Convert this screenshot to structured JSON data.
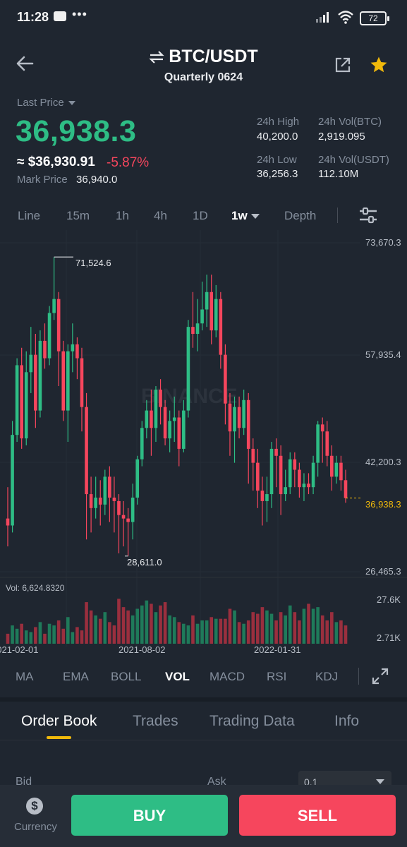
{
  "status_bar": {
    "time": "11:28",
    "dots": "•••",
    "battery": "72"
  },
  "header": {
    "pair": "BTC/USDT",
    "contract": "Quarterly 0624",
    "icons": {
      "back": "arrow-left-icon",
      "swap": "swap-arrows-icon",
      "share": "share-icon",
      "favorite": "star-icon"
    },
    "favorite_color": "#f0b90b"
  },
  "price": {
    "last_price_label": "Last Price",
    "last_price": "36,938.3",
    "approx_usd": "≈ $36,930.91",
    "change_pct": "-5.87%",
    "mark_price_label": "Mark Price",
    "mark_price": "36,940.0",
    "colors": {
      "up": "#2ebd85",
      "down": "#f6465d"
    }
  },
  "stats": {
    "high_label": "24h High",
    "high": "40,200.0",
    "vol_btc_label": "24h Vol(BTC)",
    "vol_btc": "2,919.095",
    "low_label": "24h Low",
    "low": "36,256.3",
    "vol_usdt_label": "24h Vol(USDT)",
    "vol_usdt": "112.10M"
  },
  "timeframes": {
    "items": [
      "Line",
      "15m",
      "1h",
      "4h",
      "1D",
      "1w",
      "Depth"
    ],
    "active": "1w"
  },
  "chart_data": {
    "type": "candlestick",
    "watermark": "BINANCE",
    "price_axis": [
      "73,670.3",
      "57,935.4",
      "42,200.3",
      "26,465.3"
    ],
    "current_price": "36,938.3",
    "annotations": {
      "high": "71,524.6",
      "low": "28,611.0"
    },
    "volume_label": "Vol: 6,624.8320",
    "volume_axis": [
      "27.6K",
      "2.71K"
    ],
    "dates": [
      "2021-02-01",
      "2021-08-02",
      "2022-01-31"
    ],
    "ylim": [
      26465.3,
      73670.3
    ],
    "candles": [
      [
        34000,
        33000,
        38500,
        30000
      ],
      [
        33000,
        46000,
        48000,
        32000
      ],
      [
        46000,
        56000,
        57000,
        45000
      ],
      [
        56000,
        45500,
        58500,
        44000
      ],
      [
        45500,
        55000,
        58000,
        44500
      ],
      [
        55000,
        57500,
        61500,
        52000
      ],
      [
        57500,
        49500,
        60500,
        47000
      ],
      [
        49500,
        59500,
        61000,
        48500
      ],
      [
        59500,
        57000,
        62000,
        55500
      ],
      [
        57000,
        63500,
        64500,
        56000
      ],
      [
        63500,
        65500,
        71524.6,
        62500
      ],
      [
        65500,
        58000,
        66500,
        53000
      ],
      [
        58000,
        49500,
        59500,
        48000
      ],
      [
        49500,
        58000,
        59000,
        45000
      ],
      [
        58000,
        59000,
        62000,
        55000
      ],
      [
        59000,
        57000,
        60000,
        54000
      ],
      [
        57000,
        50000,
        58500,
        46500
      ],
      [
        50000,
        37500,
        52000,
        31000
      ],
      [
        37500,
        35500,
        40000,
        32000
      ],
      [
        35500,
        37000,
        40000,
        34000
      ],
      [
        37000,
        36000,
        39500,
        33000
      ],
      [
        36000,
        40000,
        41000,
        34500
      ],
      [
        40000,
        37000,
        41500,
        33500
      ],
      [
        37000,
        36500,
        40000,
        32000
      ],
      [
        36500,
        34500,
        37500,
        29000
      ],
      [
        34500,
        34000,
        36500,
        30000
      ],
      [
        34000,
        33500,
        35500,
        28611.0
      ],
      [
        33500,
        37000,
        39000,
        31000
      ],
      [
        37000,
        42500,
        43000,
        36000
      ],
      [
        42500,
        47000,
        48000,
        41500
      ],
      [
        47000,
        49500,
        51000,
        45500
      ],
      [
        49500,
        47000,
        52500,
        43000
      ],
      [
        47000,
        52500,
        53000,
        45000
      ],
      [
        52500,
        50000,
        54000,
        47500
      ],
      [
        50000,
        45500,
        51000,
        44500
      ],
      [
        45500,
        48000,
        49500,
        43500
      ],
      [
        48000,
        48500,
        51500,
        45000
      ],
      [
        48500,
        44000,
        49500,
        41500
      ],
      [
        44000,
        49500,
        51000,
        43500
      ],
      [
        49500,
        61500,
        62500,
        48500
      ],
      [
        61500,
        60500,
        66500,
        58500
      ],
      [
        60500,
        62000,
        65500,
        58000
      ],
      [
        62000,
        64000,
        68000,
        61000
      ],
      [
        64000,
        66500,
        69000,
        61500
      ],
      [
        66500,
        61000,
        69000,
        59000
      ],
      [
        61000,
        65500,
        67500,
        60000
      ],
      [
        65500,
        57500,
        66500,
        55500
      ],
      [
        57500,
        50500,
        59000,
        47500
      ],
      [
        50500,
        46500,
        52000,
        43000
      ],
      [
        46500,
        50000,
        51500,
        42000
      ],
      [
        50000,
        47000,
        51500,
        45500
      ],
      [
        47000,
        51000,
        52500,
        46000
      ],
      [
        51000,
        44000,
        52000,
        39000
      ],
      [
        44000,
        42000,
        45500,
        38000
      ],
      [
        42000,
        38000,
        44000,
        35500
      ],
      [
        38000,
        36500,
        40000,
        33000
      ],
      [
        36500,
        37500,
        40000,
        33500
      ],
      [
        37500,
        44000,
        45000,
        35500
      ],
      [
        44000,
        43000,
        45500,
        38500
      ],
      [
        43000,
        37500,
        44500,
        34500
      ],
      [
        37500,
        38500,
        41000,
        36500
      ],
      [
        38500,
        42500,
        43500,
        37500
      ],
      [
        42500,
        41000,
        43500,
        38500
      ],
      [
        41000,
        38500,
        42000,
        37000
      ],
      [
        38500,
        39000,
        40500,
        36500
      ],
      [
        39000,
        38500,
        40500,
        37500
      ],
      [
        38500,
        42000,
        43000,
        37500
      ],
      [
        42000,
        47500,
        48000,
        40000
      ],
      [
        47500,
        46500,
        48500,
        42000
      ],
      [
        46500,
        43000,
        48000,
        41500
      ],
      [
        43000,
        40000,
        44500,
        38000
      ],
      [
        40000,
        42000,
        43000,
        39000
      ],
      [
        42000,
        39500,
        43000,
        38000
      ],
      [
        39500,
        36938.3,
        41000,
        36256.3
      ]
    ],
    "volume": [
      6,
      11,
      9,
      12,
      8,
      7,
      10,
      13,
      6,
      12,
      11,
      14,
      9,
      16,
      7,
      10,
      8,
      25,
      20,
      17,
      15,
      19,
      13,
      11,
      27,
      22,
      20,
      17,
      21,
      23,
      26,
      24,
      19,
      23,
      25,
      17,
      16,
      13,
      12,
      11,
      17,
      12,
      14,
      14,
      16,
      15,
      15,
      15,
      21,
      20,
      13,
      12,
      14,
      19,
      18,
      22,
      20,
      18,
      14,
      19,
      17,
      23,
      19,
      14,
      21,
      24,
      21,
      22,
      17,
      14,
      19,
      13,
      14,
      11
    ],
    "colors": {
      "up": "#2ebd85",
      "down": "#f6465d"
    }
  },
  "indicators": {
    "items": [
      "MA",
      "EMA",
      "BOLL",
      "VOL",
      "MACD",
      "RSI",
      "KDJ"
    ],
    "active": "VOL"
  },
  "tabs": {
    "items": [
      "Order Book",
      "Trades",
      "Trading Data",
      "Info"
    ],
    "active": "Order Book"
  },
  "order_book": {
    "bid_label": "Bid",
    "ask_label": "Ask",
    "depth_value": "0.1"
  },
  "bottom": {
    "currency_label": "Currency",
    "currency_icon": "dollar-coin-icon",
    "buy": "BUY",
    "sell": "SELL"
  },
  "accent_color": "#f0b90b"
}
